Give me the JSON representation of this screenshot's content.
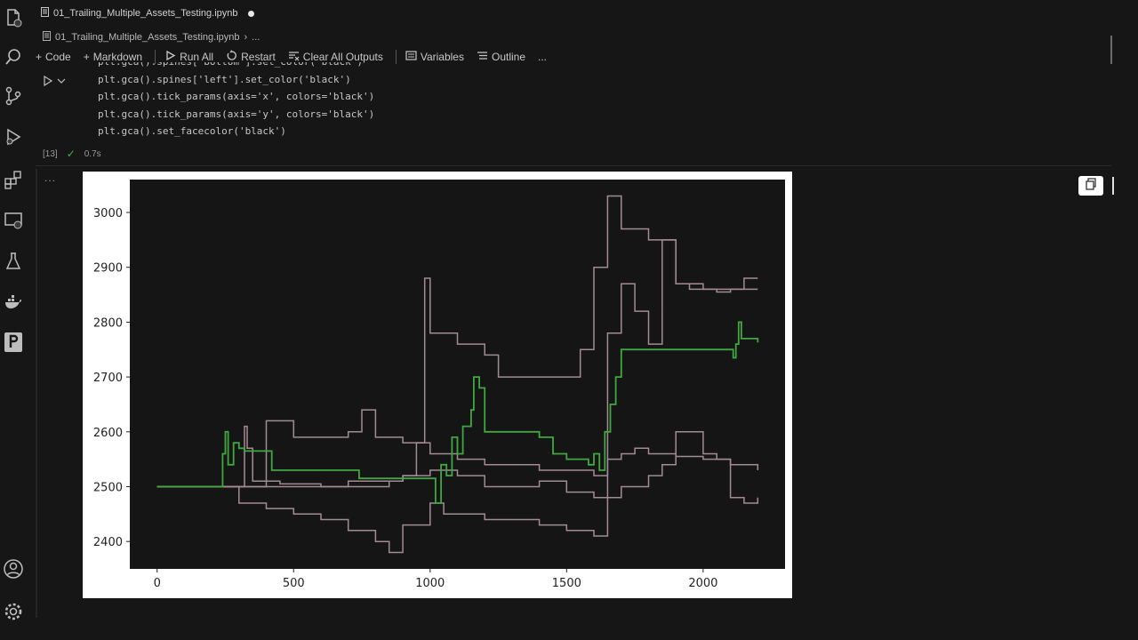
{
  "tab": {
    "filename": "01_Trailing_Multiple_Assets_Testing.ipynb"
  },
  "breadcrumb": {
    "file": "01_Trailing_Multiple_Assets_Testing.ipynb",
    "more": "..."
  },
  "toolbar": {
    "code": "Code",
    "markdown": "Markdown",
    "run_all": "Run All",
    "restart": "Restart",
    "clear_all": "Clear All Outputs",
    "variables": "Variables",
    "outline": "Outline",
    "more": "..."
  },
  "cell": {
    "lines": [
      "plt.gca().spines['bottom'].set_color('black')",
      "plt.gca().spines['left'].set_color('black')",
      "plt.gca().tick_params(axis='x', colors='black')",
      "plt.gca().tick_params(axis='y', colors='black')",
      "plt.gca().set_facecolor('black')"
    ],
    "exec_count": "[13]",
    "duration": "0.7s"
  },
  "output": {
    "dots": "..."
  },
  "colors": {
    "accent_green": "#3fa83f",
    "series_mauve": "#a38b94",
    "plot_bg": "#151515"
  },
  "chart_data": {
    "type": "line",
    "title": "",
    "xlabel": "",
    "ylabel": "",
    "xlim": [
      -100,
      2300
    ],
    "ylim": [
      2350,
      3060
    ],
    "xticks": [
      "0",
      "500",
      "1000",
      "1500",
      "2000"
    ],
    "yticks": [
      "2400",
      "2500",
      "2600",
      "2700",
      "2800",
      "2900",
      "3000"
    ],
    "series": [
      {
        "color": "#3fa83f",
        "x": [
          0,
          220,
          240,
          250,
          260,
          280,
          300,
          320,
          400,
          420,
          700,
          740,
          1000,
          1020,
          1040,
          1060,
          1080,
          1100,
          1120,
          1150,
          1160,
          1180,
          1200,
          1300,
          1400,
          1450,
          1500,
          1550,
          1580,
          1600,
          1620,
          1640,
          1660,
          1680,
          1700,
          1750,
          1800,
          2000,
          2100,
          2110,
          2120,
          2130,
          2140,
          2200
        ],
        "y": [
          2500,
          2500,
          2560,
          2600,
          2540,
          2580,
          2570,
          2565,
          2565,
          2530,
          2530,
          2515,
          2515,
          2470,
          2540,
          2520,
          2590,
          2560,
          2610,
          2640,
          2700,
          2680,
          2600,
          2600,
          2590,
          2560,
          2550,
          2550,
          2540,
          2560,
          2530,
          2600,
          2650,
          2700,
          2750,
          2750,
          2750,
          2750,
          2750,
          2735,
          2760,
          2800,
          2770,
          2763
        ]
      },
      {
        "color": "#a38b94",
        "x": [
          0,
          300,
          320,
          330,
          350,
          400,
          450,
          500,
          550,
          600,
          650,
          700,
          760,
          800,
          850,
          900,
          950,
          980,
          1000,
          1050,
          1100,
          1150,
          1200,
          1250,
          1300,
          1400,
          1500,
          1550,
          1600,
          1650,
          1700,
          1800,
          1900,
          2000,
          2100,
          2200
        ],
        "y": [
          2500,
          2500,
          2610,
          2570,
          2510,
          2510,
          2505,
          2505,
          2505,
          2500,
          2500,
          2500,
          2500,
          2500,
          2510,
          2520,
          2580,
          2880,
          2780,
          2780,
          2760,
          2760,
          2740,
          2700,
          2700,
          2700,
          2700,
          2750,
          2900,
          3030,
          2970,
          2950,
          2870,
          2860,
          2860,
          2860
        ]
      },
      {
        "color": "#a38b94",
        "x": [
          0,
          250,
          300,
          350,
          400,
          500,
          600,
          700,
          800,
          850,
          900,
          1000,
          1050,
          1100,
          1200,
          1300,
          1400,
          1500,
          1600,
          1650,
          1700,
          1750,
          1800,
          1900,
          2000,
          2100,
          2200
        ],
        "y": [
          2500,
          2500,
          2470,
          2470,
          2460,
          2450,
          2440,
          2420,
          2400,
          2380,
          2430,
          2470,
          2450,
          2450,
          2440,
          2440,
          2430,
          2420,
          2410,
          2550,
          2560,
          2570,
          2560,
          2555,
          2550,
          2540,
          2530
        ]
      },
      {
        "color": "#a38b94",
        "x": [
          0,
          350,
          400,
          500,
          600,
          700,
          750,
          800,
          900,
          1000,
          1050,
          1100,
          1200,
          1300,
          1400,
          1500,
          1600,
          1650,
          1700,
          1750,
          1800,
          1850,
          1900,
          1950,
          2000,
          2050,
          2100,
          2150,
          2200
        ],
        "y": [
          2500,
          2500,
          2620,
          2590,
          2590,
          2600,
          2640,
          2590,
          2580,
          2560,
          2560,
          2550,
          2540,
          2540,
          2530,
          2530,
          2520,
          2780,
          2870,
          2820,
          2760,
          2950,
          2870,
          2860,
          2860,
          2855,
          2860,
          2880,
          2880
        ]
      },
      {
        "color": "#a38b94",
        "x": [
          0,
          400,
          500,
          600,
          700,
          800,
          900,
          1000,
          1100,
          1200,
          1300,
          1400,
          1500,
          1600,
          1700,
          1800,
          1850,
          1900,
          2000,
          2050,
          2100,
          2150,
          2200
        ],
        "y": [
          2500,
          2500,
          2500,
          2500,
          2510,
          2510,
          2520,
          2530,
          2520,
          2500,
          2500,
          2510,
          2490,
          2480,
          2500,
          2520,
          2540,
          2600,
          2560,
          2550,
          2480,
          2470,
          2480
        ]
      }
    ]
  }
}
